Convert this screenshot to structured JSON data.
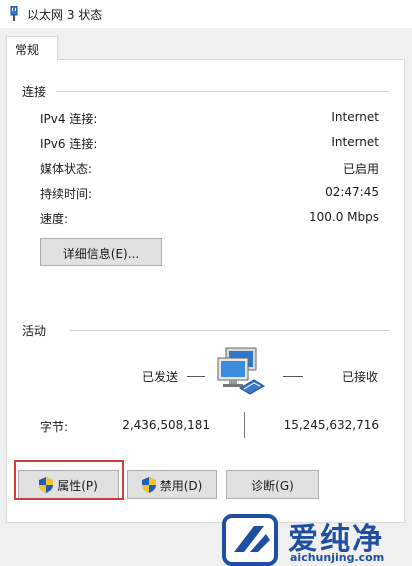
{
  "window": {
    "title": "以太网 3 状态"
  },
  "tabs": [
    {
      "label": "常规"
    }
  ],
  "connection": {
    "section_label": "连接",
    "rows": [
      {
        "label": "IPv4 连接:",
        "value": "Internet"
      },
      {
        "label": "IPv6 连接:",
        "value": "Internet"
      },
      {
        "label": "媒体状态:",
        "value": "已启用"
      },
      {
        "label": "持续时间:",
        "value": "02:47:45"
      },
      {
        "label": "速度:",
        "value": "100.0 Mbps"
      }
    ],
    "details_button": "详细信息(E)..."
  },
  "activity": {
    "section_label": "活动",
    "sent_label": "已发送",
    "received_label": "已接收",
    "bytes_label": "字节:",
    "bytes_sent": "2,436,508,181",
    "bytes_received": "15,245,632,716"
  },
  "buttons": {
    "properties": "属性(P)",
    "disable": "禁用(D)",
    "diagnose": "诊断(G)"
  },
  "watermark": {
    "text": "爱纯净",
    "url": "aichunjing.com"
  },
  "colors": {
    "highlight": "#d43b3b",
    "watermark": "#1e4fa0"
  },
  "icons": {
    "title": "network-adapter-icon",
    "activity": "network-computers-icon",
    "uac": "uac-shield-icon"
  }
}
